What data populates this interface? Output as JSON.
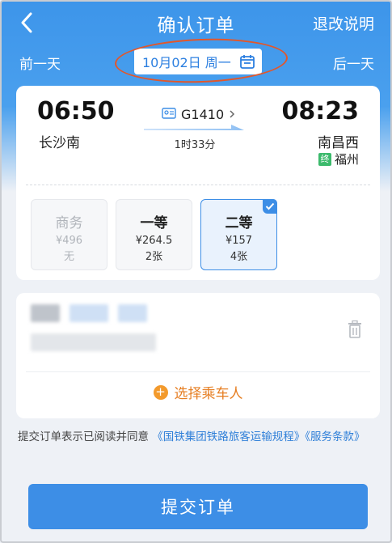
{
  "header": {
    "title": "确认订单",
    "refund_link": "退改说明"
  },
  "date_bar": {
    "prev_day": "前一天",
    "date": "10月02日 周一",
    "next_day": "后一天"
  },
  "train": {
    "departure_time": "06:50",
    "departure_station": "长沙南",
    "train_number": "G1410",
    "duration": "1时33分",
    "arrival_time": "08:23",
    "arrival_station": "南昌西",
    "terminus_badge": "终",
    "terminus_station": "福州"
  },
  "seats": [
    {
      "name": "商务",
      "price": "¥496",
      "count": "无",
      "state": "disabled"
    },
    {
      "name": "一等",
      "price": "¥264.5",
      "count": "2张",
      "state": "available"
    },
    {
      "name": "二等",
      "price": "¥157",
      "count": "4张",
      "state": "selected"
    }
  ],
  "passenger": {
    "add_label": "选择乘车人"
  },
  "agreement": {
    "prefix": "提交订单表示已阅读并同意",
    "link1": "《国铁集团铁路旅客运输规程》",
    "link2": "《服务条款》"
  },
  "submit_label": "提交订单",
  "colors": {
    "brand_blue": "#3d8ee6",
    "orange": "#e67e22",
    "annotation_red": "#e2572b",
    "terminus_green": "#3cba6c"
  }
}
